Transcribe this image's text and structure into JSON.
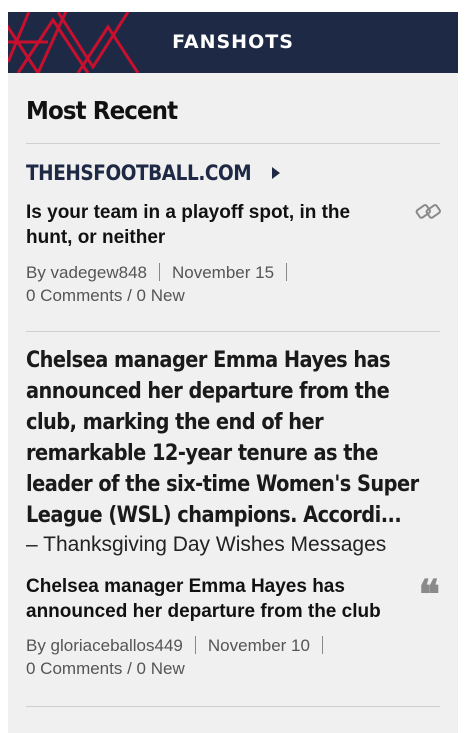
{
  "banner": {
    "title": "FANSHOTS",
    "background_color": "#1e2a45",
    "accent_color": "#c8102e"
  },
  "section": {
    "title": "Most Recent"
  },
  "posts": [
    {
      "source": "THEHSFOOTBALL.COM",
      "title": "Is your team in a playoff spot, in the hunt, or neither",
      "author": "By vadegew848",
      "date": "November 15",
      "comments": "0 Comments / 0 New",
      "icon": "link-icon"
    },
    {
      "quote": "Chelsea manager Emma Hayes has announced her departure from the club, marking the end of her remarkable 12-year tenure as the leader of the six-time Women's Super League (WSL) champions. Accordi...",
      "quote_source": "– Thanksgiving Day Wishes Messages",
      "title": "Chelsea manager Emma Hayes has announced her departure from the club",
      "author": "By gloriaceballos449",
      "date": "November 10",
      "comments": "0 Comments / 0 New",
      "icon": "quote-icon",
      "quote_mark": "❝"
    }
  ]
}
